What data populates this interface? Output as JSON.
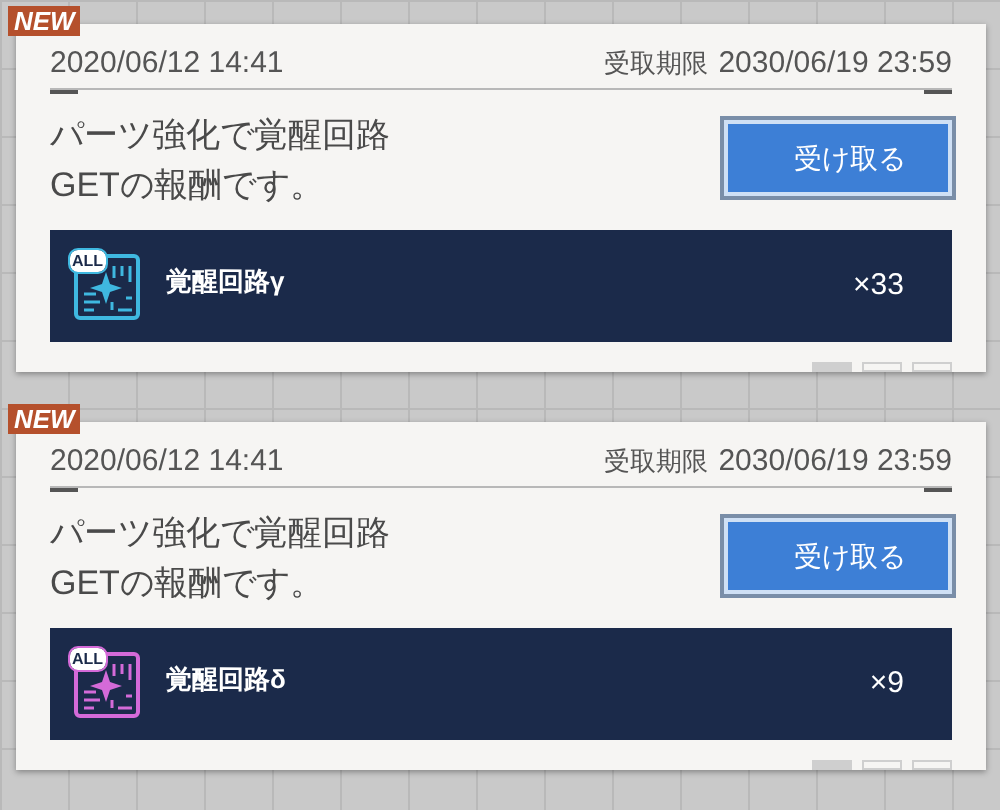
{
  "cards": [
    {
      "badge": "NEW",
      "date": "2020/06/12 14:41",
      "deadline_label": "受取期限",
      "deadline": "2030/06/19 23:59",
      "message": "パーツ強化で覚醒回路\nGETの報酬です。",
      "button": "受け取る",
      "item": {
        "icon_label": "ALL",
        "color": "#3fb8e0",
        "name": "覚醒回路γ",
        "count": "×33"
      }
    },
    {
      "badge": "NEW",
      "date": "2020/06/12 14:41",
      "deadline_label": "受取期限",
      "deadline": "2030/06/19 23:59",
      "message": "パーツ強化で覚醒回路\nGETの報酬です。",
      "button": "受け取る",
      "item": {
        "icon_label": "ALL",
        "color": "#d46ad8",
        "name": "覚醒回路δ",
        "count": "×9"
      }
    }
  ]
}
